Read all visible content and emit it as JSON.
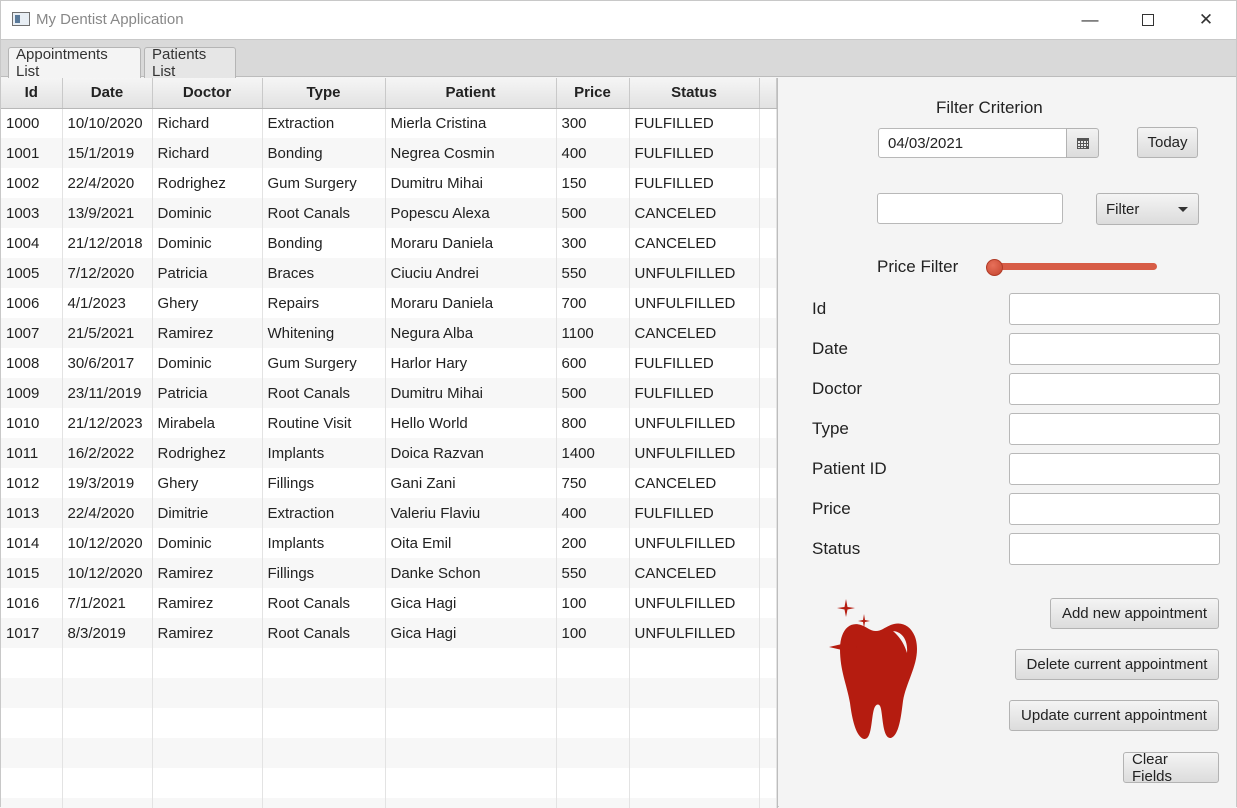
{
  "window": {
    "title": "My Dentist Application",
    "minimize_glyph": "—",
    "close_glyph": "✕"
  },
  "tabs": [
    {
      "label": "Appointments List",
      "active": true
    },
    {
      "label": "Patients List",
      "active": false
    }
  ],
  "table": {
    "columns": [
      "Id",
      "Date",
      "Doctor",
      "Type",
      "Patient",
      "Price",
      "Status"
    ],
    "rows": [
      [
        "1000",
        "10/10/2020",
        "Richard",
        "Extraction",
        "Mierla Cristina",
        "300",
        "FULFILLED"
      ],
      [
        "1001",
        "15/1/2019",
        "Richard",
        "Bonding",
        "Negrea Cosmin",
        "400",
        "FULFILLED"
      ],
      [
        "1002",
        "22/4/2020",
        "Rodrighez",
        "Gum Surgery",
        "Dumitru Mihai",
        "150",
        "FULFILLED"
      ],
      [
        "1003",
        "13/9/2021",
        "Dominic",
        "Root Canals",
        "Popescu Alexa",
        "500",
        "CANCELED"
      ],
      [
        "1004",
        "21/12/2018",
        "Dominic",
        "Bonding",
        "Moraru Daniela",
        "300",
        "CANCELED"
      ],
      [
        "1005",
        "7/12/2020",
        "Patricia",
        "Braces",
        "Ciuciu Andrei",
        "550",
        "UNFULFILLED"
      ],
      [
        "1006",
        "4/1/2023",
        "Ghery",
        "Repairs",
        "Moraru Daniela",
        "700",
        "UNFULFILLED"
      ],
      [
        "1007",
        "21/5/2021",
        "Ramirez",
        "Whitening",
        "Negura Alba",
        "1100",
        "CANCELED"
      ],
      [
        "1008",
        "30/6/2017",
        "Dominic",
        "Gum Surgery",
        "Harlor Hary",
        "600",
        "FULFILLED"
      ],
      [
        "1009",
        "23/11/2019",
        "Patricia",
        "Root Canals",
        "Dumitru Mihai",
        "500",
        "FULFILLED"
      ],
      [
        "1010",
        "21/12/2023",
        "Mirabela",
        "Routine Visit",
        "Hello World",
        "800",
        "UNFULFILLED"
      ],
      [
        "1011",
        "16/2/2022",
        "Rodrighez",
        "Implants",
        "Doica Razvan",
        "1400",
        "UNFULFILLED"
      ],
      [
        "1012",
        "19/3/2019",
        "Ghery",
        "Fillings",
        "Gani Zani",
        "750",
        "CANCELED"
      ],
      [
        "1013",
        "22/4/2020",
        "Dimitrie",
        "Extraction",
        "Valeriu Flaviu",
        "400",
        "FULFILLED"
      ],
      [
        "1014",
        "10/12/2020",
        "Dominic",
        "Implants",
        "Oita Emil",
        "200",
        "UNFULFILLED"
      ],
      [
        "1015",
        "10/12/2020",
        "Ramirez",
        "Fillings",
        "Danke Schon",
        "550",
        "CANCELED"
      ],
      [
        "1016",
        "7/1/2021",
        "Ramirez",
        "Root Canals",
        "Gica Hagi",
        "100",
        "UNFULFILLED"
      ],
      [
        "1017",
        "8/3/2019",
        "Ramirez",
        "Root Canals",
        "Gica Hagi",
        "100",
        "UNFULFILLED"
      ]
    ],
    "empty_rows": 6
  },
  "filter": {
    "title": "Filter Criterion",
    "date_value": "04/03/2021",
    "today_label": "Today",
    "text_value": "",
    "dropdown_label": "Filter",
    "price_label": "Price Filter",
    "price_slider_fraction": 0
  },
  "form": {
    "fields": [
      {
        "label": "Id",
        "value": ""
      },
      {
        "label": "Date",
        "value": ""
      },
      {
        "label": "Doctor",
        "value": ""
      },
      {
        "label": "Type",
        "value": ""
      },
      {
        "label": "Patient ID",
        "value": ""
      },
      {
        "label": "Price",
        "value": ""
      },
      {
        "label": "Status",
        "value": ""
      }
    ],
    "add_label": "Add new appointment",
    "delete_label": "Delete current appointment",
    "update_label": "Update current appointment",
    "clear_label": "Clear Fields"
  },
  "icons": {
    "calendar": "calendar-icon",
    "logo": "tooth-icon"
  },
  "colors": {
    "accent": "#d75c46",
    "logo": "#b51c10"
  }
}
